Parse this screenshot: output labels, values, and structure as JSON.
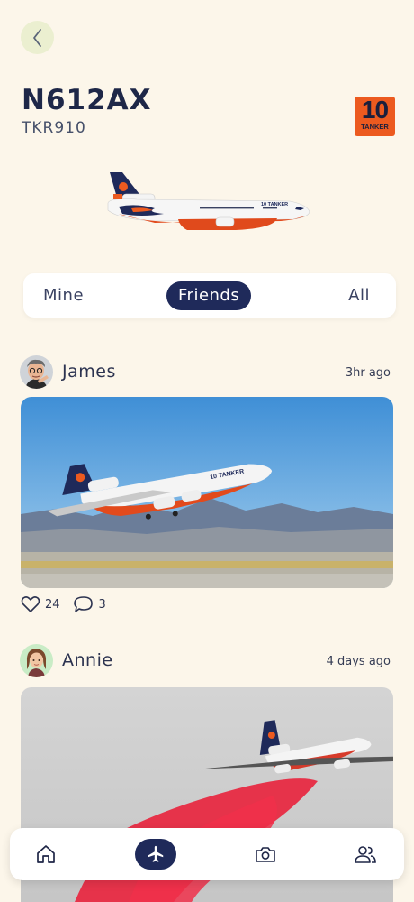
{
  "aircraft": {
    "registration": "N612AX",
    "callsign": "TKR910",
    "logo": {
      "number": "10",
      "word": "TANKER"
    }
  },
  "tabs": {
    "items": [
      "Mine",
      "Friends",
      "All"
    ],
    "selected": "Friends"
  },
  "posts": [
    {
      "user": "James",
      "time": "3hr ago",
      "likes": "24",
      "comments": "3"
    },
    {
      "user": "Annie",
      "time": "4 days ago"
    }
  ],
  "nav": {
    "items": [
      "home-icon",
      "airplane-icon",
      "camera-icon",
      "friends-icon"
    ],
    "active": "airplane-icon"
  },
  "colors": {
    "background": "#fcf6ea",
    "navy": "#1f2a5a",
    "tanker_orange": "#ec5a1f",
    "back_button": "#ebefd0"
  }
}
